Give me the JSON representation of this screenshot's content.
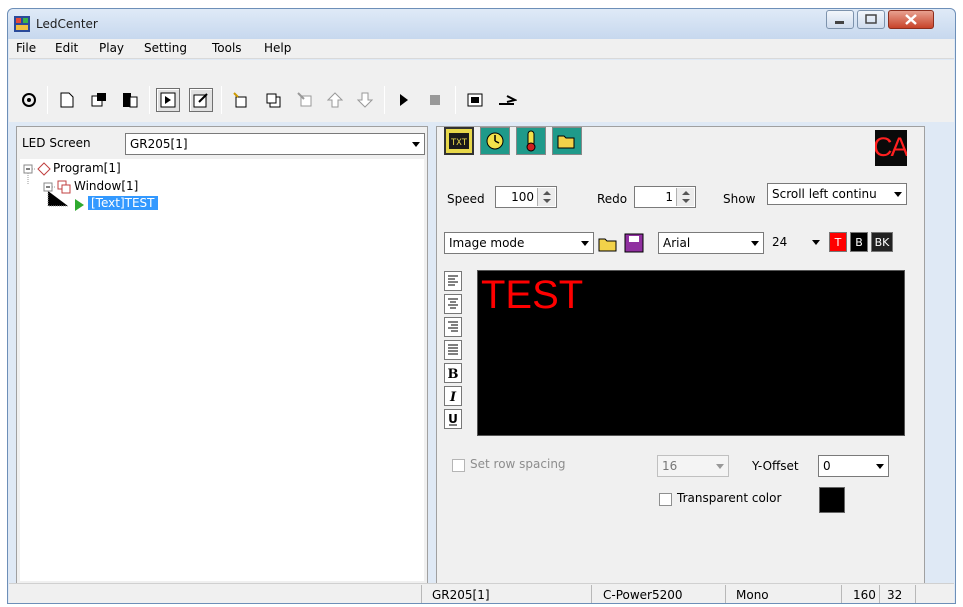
{
  "window": {
    "title": "LedCenter"
  },
  "menu": [
    "File",
    "Edit",
    "Play",
    "Setting",
    "Tools",
    "Help"
  ],
  "left": {
    "led_screen_label": "LED Screen",
    "led_screen_value": "GR205[1]",
    "tree": {
      "program": "Program[1]",
      "window": "Window[1]",
      "text": "[Text]TEST"
    }
  },
  "right": {
    "speed_label": "Speed",
    "speed_value": "100",
    "redo_label": "Redo",
    "redo_value": "1",
    "show_label": "Show",
    "show_value": "Scroll left continu",
    "mode_value": "Image mode",
    "font_value": "Arial",
    "size_value": "24",
    "color_buttons": [
      "T",
      "B",
      "BK"
    ],
    "preview_text": "TEST",
    "row_spacing_label": "Set row spacing",
    "row_spacing_value": "16",
    "y_offset_label": "Y-Offset",
    "y_offset_value": "0",
    "transparent_label": "Transparent color",
    "logo_text": "CAE"
  },
  "status": [
    "GR205[1]",
    "C-Power5200",
    "Mono",
    "160",
    "32"
  ]
}
